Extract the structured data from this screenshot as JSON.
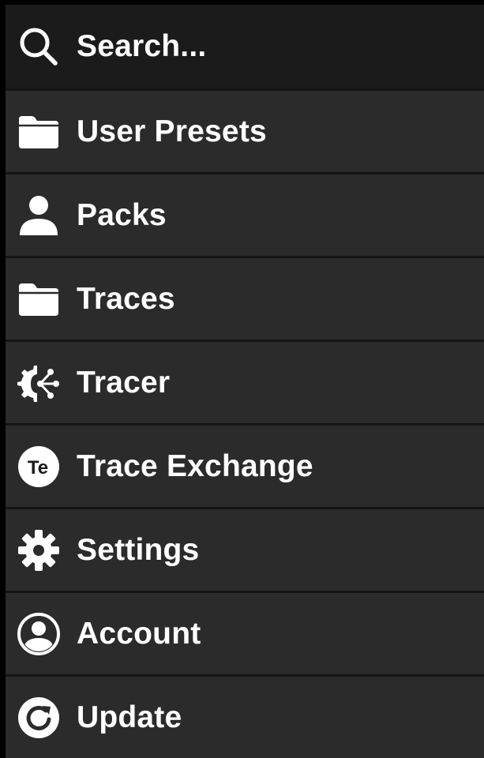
{
  "search": {
    "placeholder": "Search...",
    "icon": "search-icon"
  },
  "menu": {
    "items": [
      {
        "label": "User Presets",
        "icon": "folder-icon"
      },
      {
        "label": "Packs",
        "icon": "user-icon"
      },
      {
        "label": "Traces",
        "icon": "folder-icon"
      },
      {
        "label": "Tracer",
        "icon": "tracer-gear-icon"
      },
      {
        "label": "Trace Exchange",
        "icon": "trace-exchange-logo-icon",
        "badge": "Te"
      },
      {
        "label": "Settings",
        "icon": "gear-icon"
      },
      {
        "label": "Account",
        "icon": "account-circle-icon"
      },
      {
        "label": "Update",
        "icon": "refresh-icon"
      }
    ]
  },
  "colors": {
    "background": "#000000",
    "search_bar": "#1b1b1b",
    "item_background": "#2b2b2b",
    "separator": "#151515",
    "text": "#ffffff"
  }
}
